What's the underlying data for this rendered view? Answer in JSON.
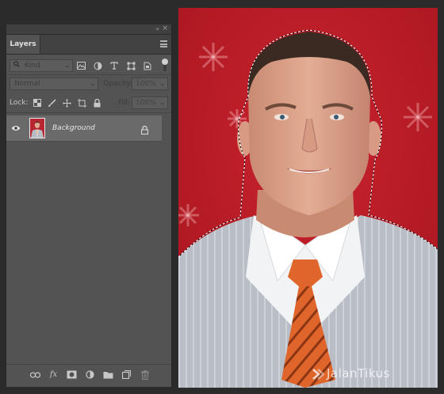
{
  "panel": {
    "tab_label": "Layers",
    "collapse_glyph": "»",
    "close_glyph": "×"
  },
  "filter": {
    "kind_label": "Kind",
    "icons": [
      "image-filter-icon",
      "adjustment-filter-icon",
      "type-filter-icon",
      "shape-filter-icon",
      "smart-object-filter-icon"
    ]
  },
  "blend": {
    "mode": "Normal",
    "opacity_label": "Opacity:",
    "opacity_value": "100%"
  },
  "lock": {
    "label": "Lock:",
    "icons": [
      "lock-transparent-pixels-icon",
      "lock-image-pixels-icon",
      "lock-position-icon",
      "prevent-auto-nesting-icon",
      "lock-all-icon"
    ],
    "fill_label": "Fill:",
    "fill_value": "100%"
  },
  "layers": [
    {
      "name": "Background",
      "visible": true,
      "locked": true
    }
  ],
  "bottom_icons": [
    "link-layers-icon",
    "fx-icon",
    "add-mask-icon",
    "adjustment-layer-icon",
    "group-folder-icon",
    "new-layer-icon",
    "delete-layer-icon"
  ],
  "canvas": {
    "background_color": "#c1212c",
    "watermark": "JalanTikus"
  },
  "colors": {
    "panel_bg": "#535353",
    "selected_layer_bg": "#6a6a6a",
    "app_bg": "#2b2b2b"
  }
}
